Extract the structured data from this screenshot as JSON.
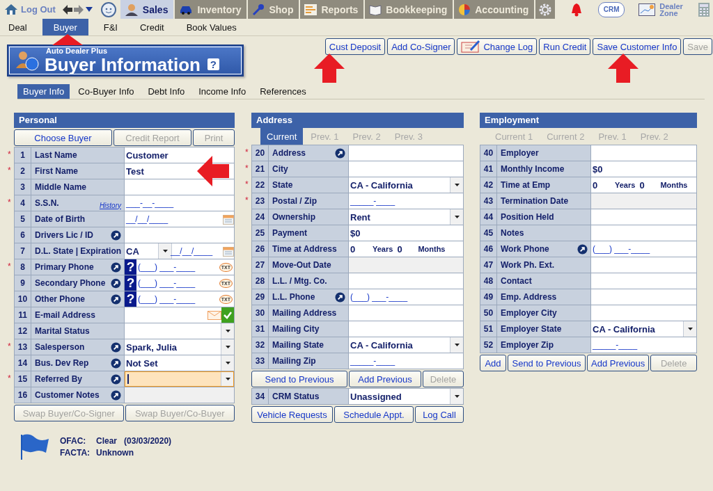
{
  "toolbar": {
    "logout": "Log Out",
    "modules": [
      {
        "label": "Sales",
        "selected": true,
        "kind": "sales"
      },
      {
        "label": "Inventory",
        "selected": false,
        "kind": "car"
      },
      {
        "label": "Shop",
        "selected": false,
        "kind": "wrench"
      },
      {
        "label": "Reports",
        "selected": false,
        "kind": "report"
      },
      {
        "label": "Bookkeeping",
        "selected": false,
        "kind": "book"
      },
      {
        "label": "Accounting",
        "selected": false,
        "kind": "pie"
      }
    ],
    "crm": "CRM",
    "dealer_zone": "Dealer Zone"
  },
  "subnav": [
    {
      "label": "Deal",
      "selected": false
    },
    {
      "label": "Buyer",
      "selected": true
    },
    {
      "label": "F&I",
      "selected": false
    },
    {
      "label": "Credit",
      "selected": false
    },
    {
      "label": "Book Values",
      "selected": false
    }
  ],
  "header": {
    "brand": "Auto Dealer Plus",
    "title": "Buyer Information",
    "help": "?"
  },
  "actions": [
    {
      "label": "Cust Deposit",
      "disabled": false,
      "kind": "plain"
    },
    {
      "label": "Add Co-Signer",
      "disabled": false,
      "kind": "plain"
    },
    {
      "label": "Change Log",
      "disabled": false,
      "kind": "notebook"
    },
    {
      "label": "Run Credit",
      "disabled": false,
      "kind": "plain"
    },
    {
      "label": "Save Customer Info",
      "disabled": false,
      "kind": "plain"
    },
    {
      "label": "Save",
      "disabled": true,
      "kind": "plain"
    }
  ],
  "section_tabs": [
    {
      "label": "Buyer Info",
      "selected": true
    },
    {
      "label": "Co-Buyer Info",
      "selected": false
    },
    {
      "label": "Debt Info",
      "selected": false
    },
    {
      "label": "Income Info",
      "selected": false
    },
    {
      "label": "References",
      "selected": false
    }
  ],
  "personal": {
    "title": "Personal",
    "buttons": [
      {
        "label": "Choose Buyer",
        "disabled": false
      },
      {
        "label": "Credit Report",
        "disabled": true
      },
      {
        "label": "Print",
        "disabled": true
      }
    ],
    "rows": [
      {
        "required_mark": "*",
        "num": "1",
        "label": "Last Name",
        "kind": "text",
        "value": "Customer"
      },
      {
        "required_mark": "*",
        "num": "2",
        "label": "First Name",
        "kind": "text",
        "value": "Test"
      },
      {
        "num": "3",
        "label": "Middle Name",
        "kind": "text"
      },
      {
        "required_mark": "*",
        "num": "4",
        "label": "S.S.N.",
        "link": "History",
        "kind": "text",
        "value": "___-__-____"
      },
      {
        "num": "5",
        "label": "Date of Birth",
        "kind": "date",
        "value": "__/__/____"
      },
      {
        "num": "6",
        "label": "Drivers Lic / ID",
        "popout": true,
        "kind": "text"
      },
      {
        "num": "7",
        "label": "D.L. State | Expiration",
        "kind": "state_date",
        "value": "CA",
        "date": "__/__/____"
      },
      {
        "required_mark": "*",
        "num": "8",
        "label": "Primary Phone",
        "popout": true,
        "kind": "phone",
        "badge": "?",
        "value": "(___) ___-____",
        "sms": "TXT"
      },
      {
        "num": "9",
        "label": "Secondary Phone",
        "popout": true,
        "kind": "phone",
        "badge": "?",
        "value": "(___) ___-____",
        "sms": "TXT"
      },
      {
        "num": "10",
        "label": "Other Phone",
        "popout": true,
        "kind": "phone",
        "badge": "?",
        "value": "(___) ___-____",
        "sms": "TXT"
      },
      {
        "num": "11",
        "label": "E-mail Address",
        "kind": "email",
        "verified": true
      },
      {
        "num": "12",
        "label": "Marital Status",
        "kind": "select",
        "focused": false
      },
      {
        "required_mark": "*",
        "num": "13",
        "label": "Salesperson",
        "popout": true,
        "kind": "select",
        "value": "Spark, Julia",
        "focused": false
      },
      {
        "num": "14",
        "label": "Bus. Dev Rep",
        "popout": true,
        "kind": "select",
        "value": "Not Set",
        "focused": false
      },
      {
        "required_mark": "*",
        "num": "15",
        "label": "Referred By",
        "popout": true,
        "kind": "select",
        "focused": true
      },
      {
        "num": "16",
        "label": "Customer Notes",
        "popout": true,
        "kind": "text",
        "disabled": true
      }
    ],
    "bottom_buttons": [
      {
        "label": "Swap Buyer/Co-Signer",
        "disabled": true
      },
      {
        "label": "Swap Buyer/Co-Buyer",
        "disabled": true
      }
    ]
  },
  "checks": [
    {
      "label": "OFAC:",
      "value": "Clear",
      "date": "(03/03/2020)"
    },
    {
      "label": "FACTA:",
      "value": "Unknown"
    }
  ],
  "address": {
    "title": "Address",
    "tabs": [
      {
        "label": "Current",
        "selected": true
      },
      {
        "label": "Prev. 1",
        "selected": false
      },
      {
        "label": "Prev. 2",
        "selected": false
      },
      {
        "label": "Prev. 3",
        "selected": false
      }
    ],
    "rows": [
      {
        "required_mark": "*",
        "num": "20",
        "label": "Address",
        "popout": true,
        "kind": "text"
      },
      {
        "required_mark": "*",
        "num": "21",
        "label": "City",
        "kind": "text"
      },
      {
        "required_mark": "*",
        "num": "22",
        "label": "State",
        "kind": "select",
        "value": "CA - California",
        "focused": false
      },
      {
        "required_mark": "*",
        "num": "23",
        "label": "Postal / Zip",
        "kind": "text",
        "value": "_____-____"
      },
      {
        "num": "24",
        "label": "Ownership",
        "kind": "select",
        "value": "Rent",
        "focused": false
      },
      {
        "num": "25",
        "label": "Payment",
        "kind": "text",
        "value": "$0"
      },
      {
        "num": "26",
        "label": "Time at Address",
        "kind": "time",
        "years": "0",
        "years_label": "Years",
        "months": "0",
        "months_label": "Months"
      },
      {
        "num": "27",
        "label": "Move-Out Date",
        "kind": "text",
        "disabled": true
      },
      {
        "num": "28",
        "label": "L.L. / Mtg. Co.",
        "kind": "text"
      },
      {
        "num": "29",
        "label": "L.L. Phone",
        "popout": true,
        "kind": "phone",
        "value": "(___) ___-____"
      },
      {
        "num": "30",
        "label": "Mailing Address",
        "kind": "text"
      },
      {
        "num": "31",
        "label": "Mailing City",
        "kind": "text"
      },
      {
        "num": "32",
        "label": "Mailing State",
        "kind": "select",
        "value": "CA - California",
        "focused": false
      },
      {
        "num": "33",
        "label": "Mailing Zip",
        "kind": "text",
        "value": "_____-____"
      }
    ],
    "buttons": [
      {
        "label": "Send to Previous",
        "disabled": false
      },
      {
        "label": "Add Previous",
        "disabled": false
      },
      {
        "label": "Delete",
        "disabled": true
      }
    ],
    "crm_rows": [
      {
        "num": "34",
        "label": "CRM Status",
        "kind": "select",
        "value": "Unassigned",
        "focused": false
      }
    ],
    "bottom_buttons": [
      {
        "label": "Vehicle Requests",
        "disabled": false
      },
      {
        "label": "Schedule Appt.",
        "disabled": false
      },
      {
        "label": "Log Call",
        "disabled": false
      }
    ]
  },
  "employment": {
    "title": "Employment",
    "tabs": [
      {
        "label": "Current 1",
        "selected": false
      },
      {
        "label": "Current 2",
        "selected": false
      },
      {
        "label": "Prev. 1",
        "selected": false
      },
      {
        "label": "Prev. 2",
        "selected": false
      }
    ],
    "rows": [
      {
        "num": "40",
        "label": "Employer",
        "kind": "text"
      },
      {
        "num": "41",
        "label": "Monthly Income",
        "kind": "text",
        "value": "$0"
      },
      {
        "num": "42",
        "label": "Time at Emp",
        "kind": "time",
        "years": "0",
        "years_label": "Years",
        "months": "0",
        "months_label": "Months"
      },
      {
        "num": "43",
        "label": "Termination Date",
        "kind": "text",
        "disabled": true
      },
      {
        "num": "44",
        "label": "Position Held",
        "kind": "text"
      },
      {
        "num": "45",
        "label": "Notes",
        "kind": "text"
      },
      {
        "num": "46",
        "label": "Work Phone",
        "popout": true,
        "kind": "phone",
        "value": "(___) ___-____"
      },
      {
        "num": "47",
        "label": "Work Ph. Ext.",
        "kind": "text"
      },
      {
        "num": "48",
        "label": "Contact",
        "kind": "text"
      },
      {
        "num": "49",
        "label": "Emp. Address",
        "kind": "text"
      },
      {
        "num": "50",
        "label": "Employer City",
        "kind": "text"
      },
      {
        "num": "51",
        "label": "Employer State",
        "kind": "select",
        "value": "CA - California",
        "focused": false
      },
      {
        "num": "52",
        "label": "Employer Zip",
        "kind": "text",
        "value": "_____-____"
      }
    ],
    "buttons": [
      {
        "label": "Add",
        "disabled": false
      },
      {
        "label": "Send to Previous",
        "disabled": false
      },
      {
        "label": "Add Previous",
        "disabled": false
      },
      {
        "label": "Delete",
        "disabled": true
      }
    ]
  }
}
